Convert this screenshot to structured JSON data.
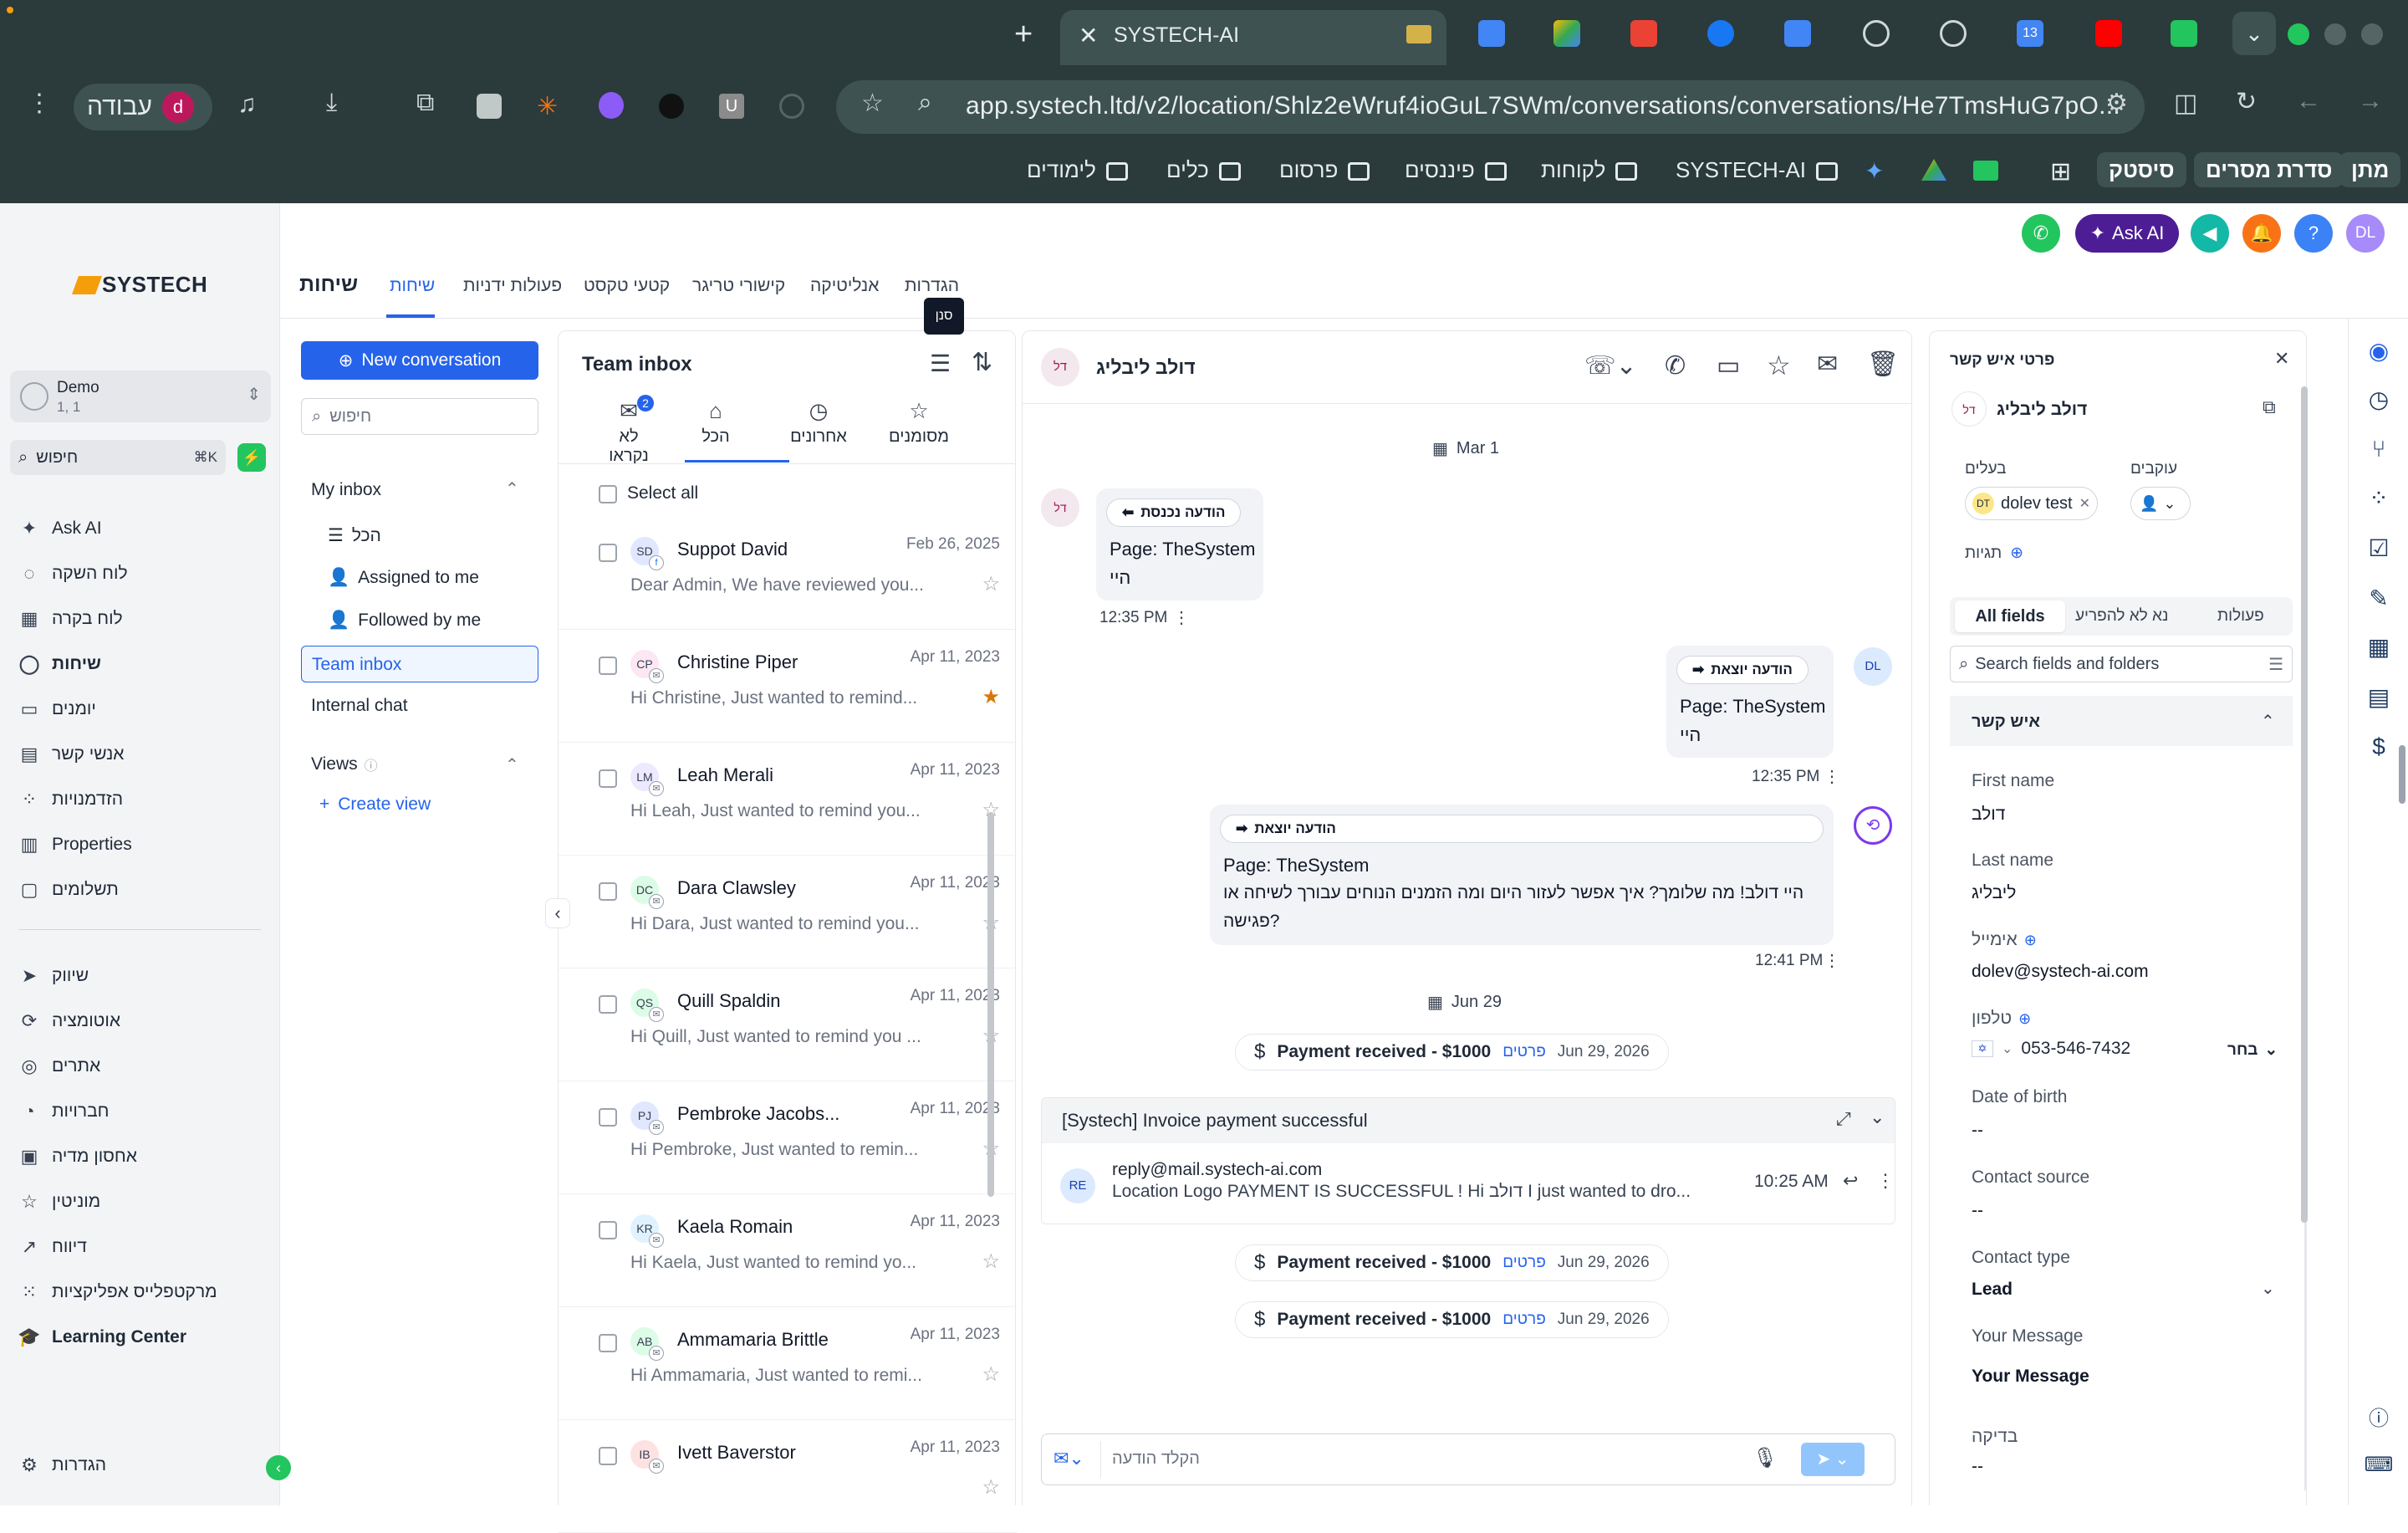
{
  "browser": {
    "tab_title": "SYSTECH-AI",
    "new_tab_symbol": "+",
    "url": "app.systech.ltd/v2/location/Shlz2eWruf4ioGuL7SWm/conversations/conversations/He7TmsHuG7pO...",
    "profile_label": "עבודה",
    "profile_initial": "d",
    "bookmarks": [
      "לימודים",
      "כלים",
      "פרסום",
      "פיננסים",
      "לקוחות",
      "SYSTECH-AI"
    ],
    "bookmark_pills": [
      "סיסטק",
      "סדרת מסרים",
      "מתן"
    ],
    "tab_icon_calendar_num": "13"
  },
  "app": {
    "logo_text": "SYSTECH",
    "account": {
      "name": "Demo",
      "sub": "1, 1"
    },
    "search": {
      "placeholder": "חיפוש",
      "shortcut": "⌘K"
    },
    "nav": [
      {
        "label": "Ask AI",
        "icon": "sparkle-icon"
      },
      {
        "label": "לוח השקה",
        "icon": "rocket-icon"
      },
      {
        "label": "לוח בקרה",
        "icon": "dashboard-icon"
      },
      {
        "label": "שיחות",
        "icon": "chat-icon",
        "active": true
      },
      {
        "label": "יומנים",
        "icon": "calendar-icon"
      },
      {
        "label": "אנשי קשר",
        "icon": "contacts-icon"
      },
      {
        "label": "הזדמנויות",
        "icon": "opportunities-icon"
      },
      {
        "label": "Properties",
        "icon": "building-icon"
      },
      {
        "label": "תשלומים",
        "icon": "payments-icon"
      },
      {
        "label": "שיווק",
        "icon": "send-icon"
      },
      {
        "label": "אוטומציה",
        "icon": "automation-icon"
      },
      {
        "label": "אתרים",
        "icon": "globe-icon"
      },
      {
        "label": "חברויות",
        "icon": "membership-icon"
      },
      {
        "label": "אחסון מדיה",
        "icon": "media-icon"
      },
      {
        "label": "מוניטין",
        "icon": "star-icon"
      },
      {
        "label": "דיווח",
        "icon": "reporting-icon"
      },
      {
        "label": "מרקטפלייס אפליקציות",
        "icon": "marketplace-icon"
      },
      {
        "label": "Learning Center",
        "icon": "graduation-icon"
      }
    ],
    "settings_label": "הגדרות",
    "header_buttons": {
      "ask_ai": "Ask AI",
      "user_initials": "DL"
    },
    "page_title": "שיחות",
    "top_tabs": [
      "שיחות",
      "פעולות ידניות",
      "קטעי טקסט",
      "קישורי טריגר",
      "אנליטיקה",
      "הגדרות"
    ]
  },
  "inbox_nav": {
    "new_conversation": "New conversation",
    "search_placeholder": "חיפוש",
    "my_inbox": "My inbox",
    "items": [
      "הכל",
      "Assigned to me",
      "Followed by me"
    ],
    "team_inbox": "Team inbox",
    "internal_chat": "Internal chat",
    "views": "Views",
    "create_view": "Create view"
  },
  "conversation_list": {
    "title": "Team inbox",
    "tooltip": "סנן",
    "tabs": [
      {
        "label": "לא נקראו",
        "badge": "2"
      },
      {
        "label": "הכל",
        "active": true
      },
      {
        "label": "אחרונים"
      },
      {
        "label": "מסומנים"
      }
    ],
    "select_all": "Select all",
    "rows": [
      {
        "initials": "SD",
        "name": "Suppot David",
        "date": "Feb 26, 2025",
        "preview": "Dear Admin, We have reviewed you...",
        "starred": false,
        "channel": "facebook"
      },
      {
        "initials": "CP",
        "name": "Christine Piper",
        "date": "Apr 11, 2023",
        "preview": "Hi Christine, Just wanted to remind...",
        "starred": true,
        "channel": "email"
      },
      {
        "initials": "LM",
        "name": "Leah Merali",
        "date": "Apr 11, 2023",
        "preview": "Hi Leah, Just wanted to remind you...",
        "starred": false,
        "channel": "email"
      },
      {
        "initials": "DC",
        "name": "Dara Clawsley",
        "date": "Apr 11, 2023",
        "preview": "Hi Dara, Just wanted to remind you...",
        "starred": false,
        "channel": "email"
      },
      {
        "initials": "QS",
        "name": "Quill Spaldin",
        "date": "Apr 11, 2023",
        "preview": "Hi Quill, Just wanted to remind you ...",
        "starred": false,
        "channel": "email"
      },
      {
        "initials": "PJ",
        "name": "Pembroke Jacobs...",
        "date": "Apr 11, 2023",
        "preview": "Hi Pembroke, Just wanted to remin...",
        "starred": false,
        "channel": "email"
      },
      {
        "initials": "KR",
        "name": "Kaela Romain",
        "date": "Apr 11, 2023",
        "preview": "Hi Kaela, Just wanted to remind yo...",
        "starred": false,
        "channel": "email"
      },
      {
        "initials": "AB",
        "name": "Ammamaria Brittle",
        "date": "Apr 11, 2023",
        "preview": "Hi Ammamaria, Just wanted to remi...",
        "starred": false,
        "channel": "email"
      },
      {
        "initials": "IB",
        "name": "Ivett Baverstor",
        "date": "Apr 11, 2023",
        "preview": "",
        "starred": false,
        "channel": "email"
      }
    ]
  },
  "conversation": {
    "contact_name": "דולב ליבליג",
    "contact_initials": "דל",
    "date1": "Mar 1",
    "msg1": {
      "badge": "הודעה נכנסת",
      "line1": "Page: TheSystem",
      "line2": "היי",
      "time": "12:35 PM"
    },
    "msg2": {
      "badge": "הודעה יוצאת",
      "line1": "Page: TheSystem",
      "line2": "היי",
      "time": "12:35 PM",
      "initials": "DL"
    },
    "msg3": {
      "badge": "הודעה יוצאת",
      "line1": "Page: TheSystem",
      "line2": "היי דולב! מה שלומך? איך אפשר לעזור היום ומה הזמנים הנוחים עבורך לשיחה או",
      "line3": "פגישה?",
      "time": "12:41 PM"
    },
    "date2": "Jun 29",
    "payment": {
      "label": "Payment received",
      "amount": "- $1000",
      "details": "פרטים",
      "date": "Jun 29, 2026"
    },
    "email": {
      "subject": "[Systech] Invoice payment successful",
      "initials": "RE",
      "from": "reply@mail.systech-ai.com",
      "preview": "Location Logo PAYMENT IS SUCCESSFUL ! Hi דולב   I just wanted to dro...",
      "time": "10:25 AM"
    },
    "composer_placeholder": "הקלד הודעה"
  },
  "contact_panel": {
    "title": "פרטי איש קשר",
    "name": "דולב ליבליג",
    "initials": "דל",
    "owner_label": "בעלים",
    "owner_value": "dolev test",
    "owner_initials": "DT",
    "followers_label": "עוקבים",
    "tags_label": "תגיות",
    "tabs": [
      "All fields",
      "נא לא להפריע",
      "פעולות"
    ],
    "search_placeholder": "Search fields and folders",
    "section": "איש קשר",
    "fields": [
      {
        "label": "First name",
        "value": "דולב"
      },
      {
        "label": "Last name",
        "value": "ליבליג"
      },
      {
        "label": "אימייל",
        "value": "dolev@systech-ai.com"
      },
      {
        "label": "טלפון",
        "value": "053-546-7432"
      },
      {
        "label": "Date of birth",
        "value": "--"
      },
      {
        "label": "Contact source",
        "value": "--"
      },
      {
        "label": "Contact type",
        "value": "Lead"
      },
      {
        "label": "Your Message",
        "value": "Your Message"
      },
      {
        "label": "בדיקה",
        "value": "--"
      }
    ],
    "phone_select": "בחר"
  },
  "colors": {
    "accent": "#2563eb",
    "chrome": "#2b3a3a",
    "ask_ai": "#4c1d95",
    "green": "#22c55e"
  }
}
